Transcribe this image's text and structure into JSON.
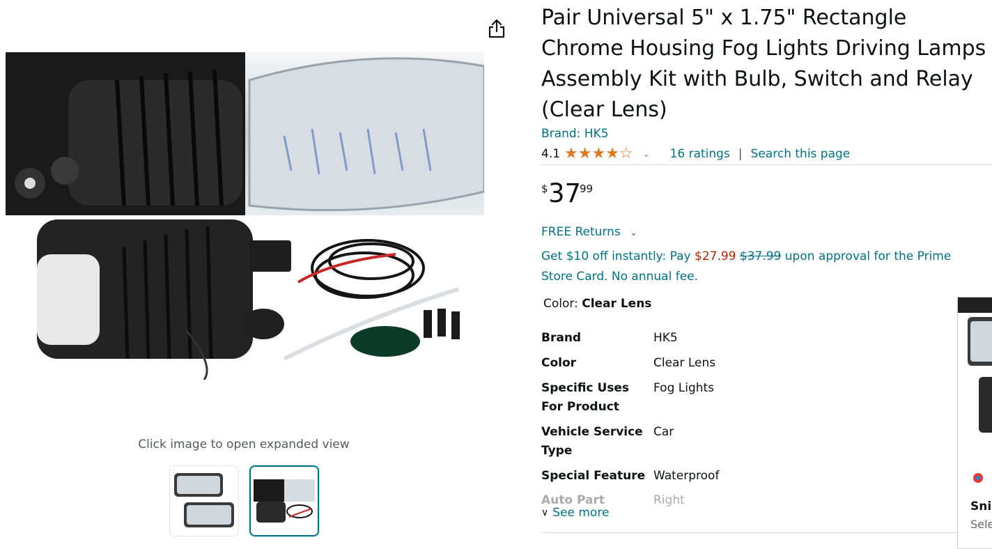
{
  "gallery": {
    "caption": "Click image to open expanded view"
  },
  "product": {
    "title": "Pair Universal 5\" x 1.75\" Rectangle Chrome Housing Fog Lights Driving Lamps Assembly Kit with Bulb, Switch and Relay (Clear Lens)",
    "brand_link": "Brand: HK5",
    "rating_value": "4.1",
    "rating_stars": 4.1,
    "ratings_count": "16 ratings",
    "separator": "|",
    "search_link": "Search this page",
    "price_symbol": "$",
    "price_whole": "37",
    "price_fraction": "99",
    "free_returns": "FREE Returns",
    "offer": {
      "prefix": "Get $10 off instantly: Pay ",
      "sale_price": "$27.99",
      "list_price": "$37.99",
      "suffix": " upon approval for the Prime Store Card. No annual fee."
    },
    "color_label": "Color: ",
    "color_value": "Clear Lens",
    "specs": [
      {
        "key": "Brand",
        "value": "HK5"
      },
      {
        "key": "Color",
        "value": "Clear Lens"
      },
      {
        "key": "Specific Uses For Product",
        "value": "Fog Lights"
      },
      {
        "key": "Vehicle Service Type",
        "value": "Car"
      },
      {
        "key": "Special Feature",
        "value": "Waterproof"
      }
    ],
    "faded_spec_key": "Auto Part",
    "faded_spec_value": "Right",
    "see_more": "See more"
  },
  "overlay": {
    "title": "Snip",
    "subtitle": "Sele"
  },
  "colors": {
    "link": "#007185",
    "star": "#de7921",
    "red_price": "#b12704"
  }
}
